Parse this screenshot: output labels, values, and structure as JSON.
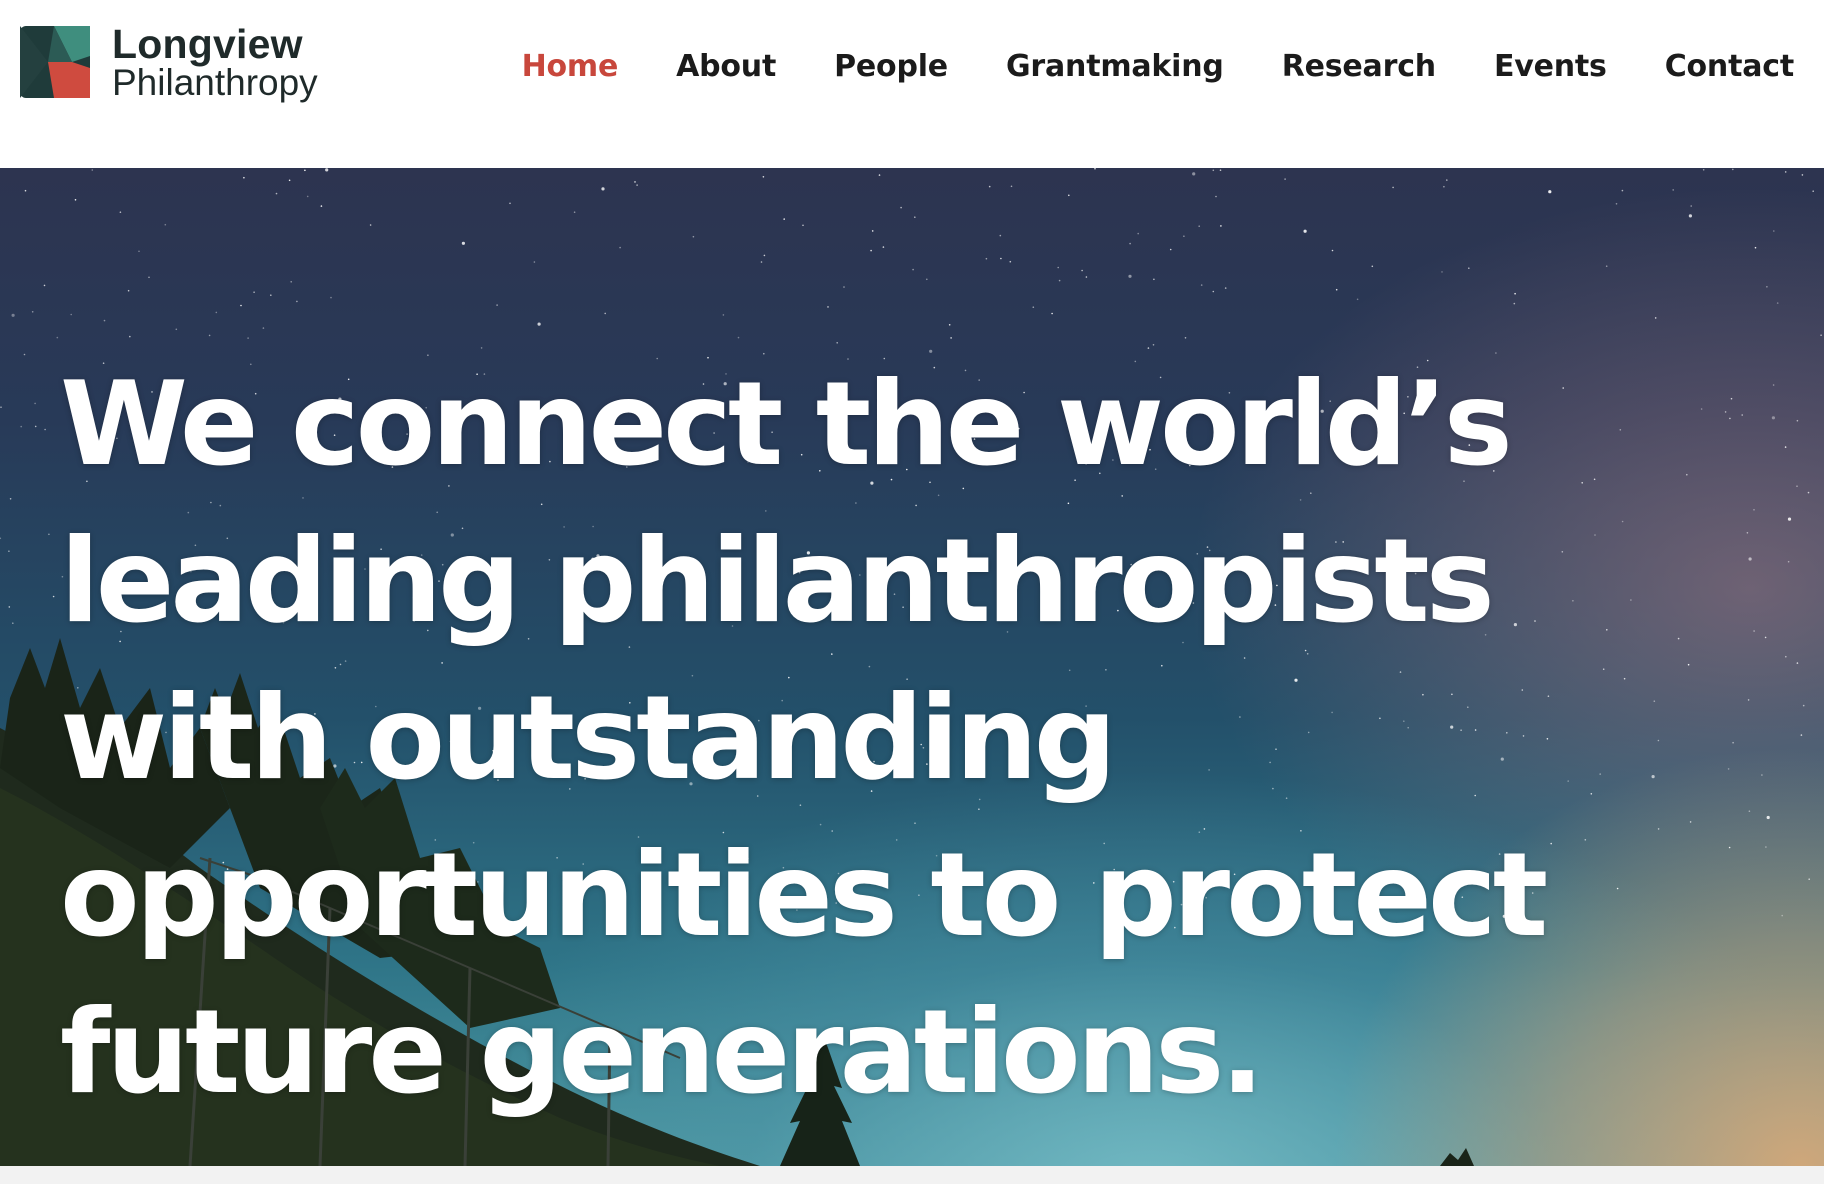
{
  "brand": {
    "name_line1": "Longview",
    "name_line2": "Philanthropy",
    "logo_colors": {
      "teal": "#2c5b55",
      "dark": "#1f3b3a",
      "red": "#cf4b3f",
      "green": "#3f8e7e"
    }
  },
  "nav": {
    "items": [
      {
        "label": "Home",
        "active": true
      },
      {
        "label": "About",
        "active": false
      },
      {
        "label": "People",
        "active": false
      },
      {
        "label": "Grantmaking",
        "active": false
      },
      {
        "label": "Research",
        "active": false
      },
      {
        "label": "Events",
        "active": false
      },
      {
        "label": "Contact",
        "active": false
      }
    ],
    "active_color": "#c8473c",
    "text_color": "#1b1b1b"
  },
  "hero": {
    "headline": "We connect the world’s leading philanthropists with outstanding opportunities to protect future generations."
  }
}
